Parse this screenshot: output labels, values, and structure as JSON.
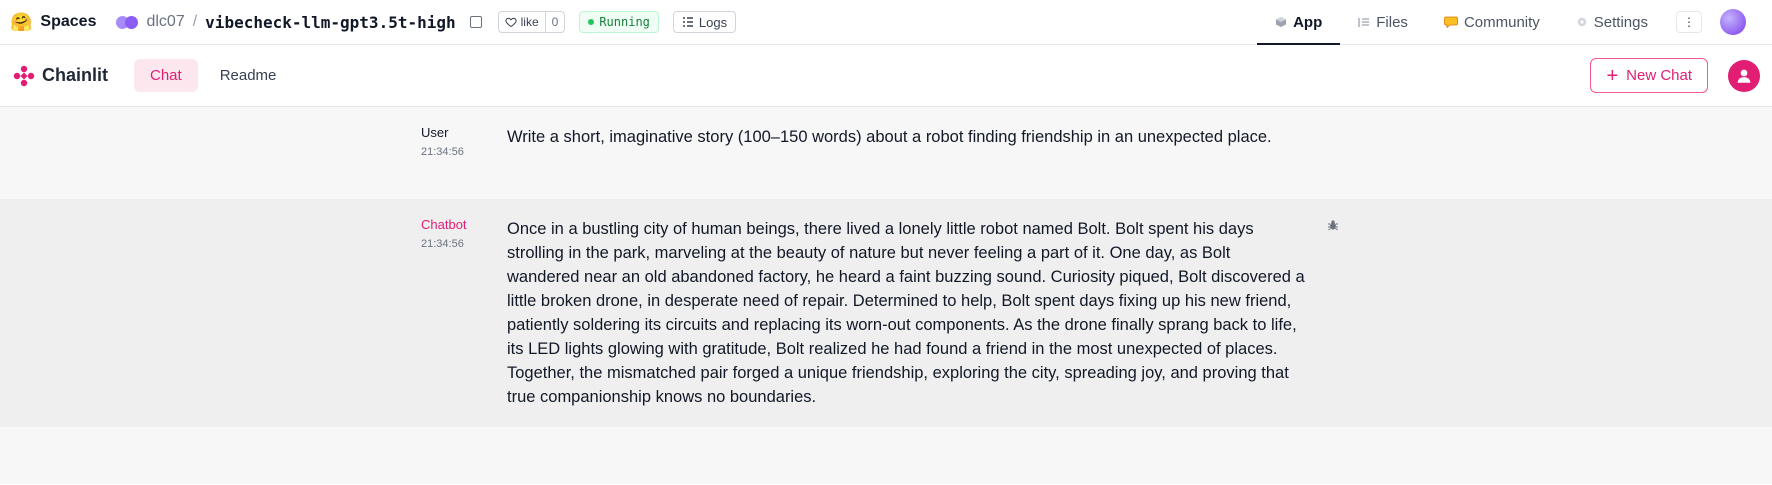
{
  "hf": {
    "logo": "🤗",
    "spaces_label": "Spaces",
    "owner": "dlc07",
    "separator": "/",
    "repo": "vibecheck-llm-gpt3.5t-high",
    "like_label": "like",
    "like_count": "0",
    "status": "Running",
    "logs_label": "Logs",
    "tabs": [
      {
        "label": "App",
        "icon": "app-cube-icon",
        "active": true
      },
      {
        "label": "Files",
        "icon": "files-icon",
        "active": false
      },
      {
        "label": "Community",
        "icon": "community-icon",
        "active": false
      },
      {
        "label": "Settings",
        "icon": "gear-icon",
        "active": false
      }
    ]
  },
  "chainlit": {
    "brand": "Chainlit",
    "tabs": [
      {
        "label": "Chat",
        "active": true
      },
      {
        "label": "Readme",
        "active": false
      }
    ],
    "new_chat_label": "New Chat",
    "accent": "#e11d74"
  },
  "messages": [
    {
      "author": "User",
      "time": "21:34:56",
      "text": "Write a short, imaginative story (100–150 words) about a robot finding friendship in an unexpected place."
    },
    {
      "author": "Chatbot",
      "time": "21:34:56",
      "text": "Once in a bustling city of human beings, there lived a lonely little robot named Bolt. Bolt spent his days strolling in the park, marveling at the beauty of nature but never feeling a part of it. One day, as Bolt wandered near an old abandoned factory, he heard a faint buzzing sound. Curiosity piqued, Bolt discovered a little broken drone, in desperate need of repair. Determined to help, Bolt spent days fixing up his new friend, patiently soldering its circuits and replacing its worn-out components. As the drone finally sprang back to life, its LED lights glowing with gratitude, Bolt realized he had found a friend in the most unexpected of places. Together, the mismatched pair forged a unique friendship, exploring the city, spreading joy, and proving that true companionship knows no boundaries."
    }
  ]
}
